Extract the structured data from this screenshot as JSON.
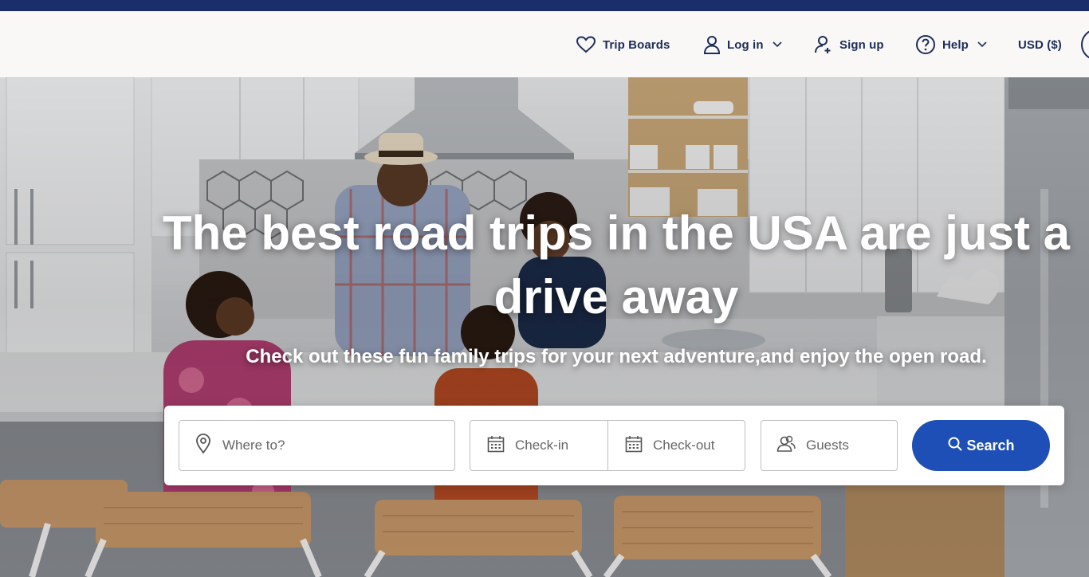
{
  "nav": {
    "trip_boards": "Trip Boards",
    "log_in": "Log in",
    "sign_up": "Sign up",
    "help": "Help",
    "currency": "USD ($)"
  },
  "hero": {
    "title": "The best road trips in the USA are just a drive away",
    "subtitle": "Check out these fun family trips for your next adventure,and enjoy the open road."
  },
  "search": {
    "where_placeholder": "Where to?",
    "checkin_placeholder": "Check-in",
    "checkout_placeholder": "Check-out",
    "guests_placeholder": "Guests",
    "button_label": "Search"
  },
  "colors": {
    "brand_dark": "#1b2d6b",
    "nav_text": "#1c2d5a",
    "search_button": "#1d4fb6"
  },
  "icons": [
    "heart-icon",
    "user-icon",
    "chevron-down-icon",
    "add-user-icon",
    "help-icon",
    "location-pin-icon",
    "calendar-icon",
    "users-icon",
    "search-icon"
  ]
}
